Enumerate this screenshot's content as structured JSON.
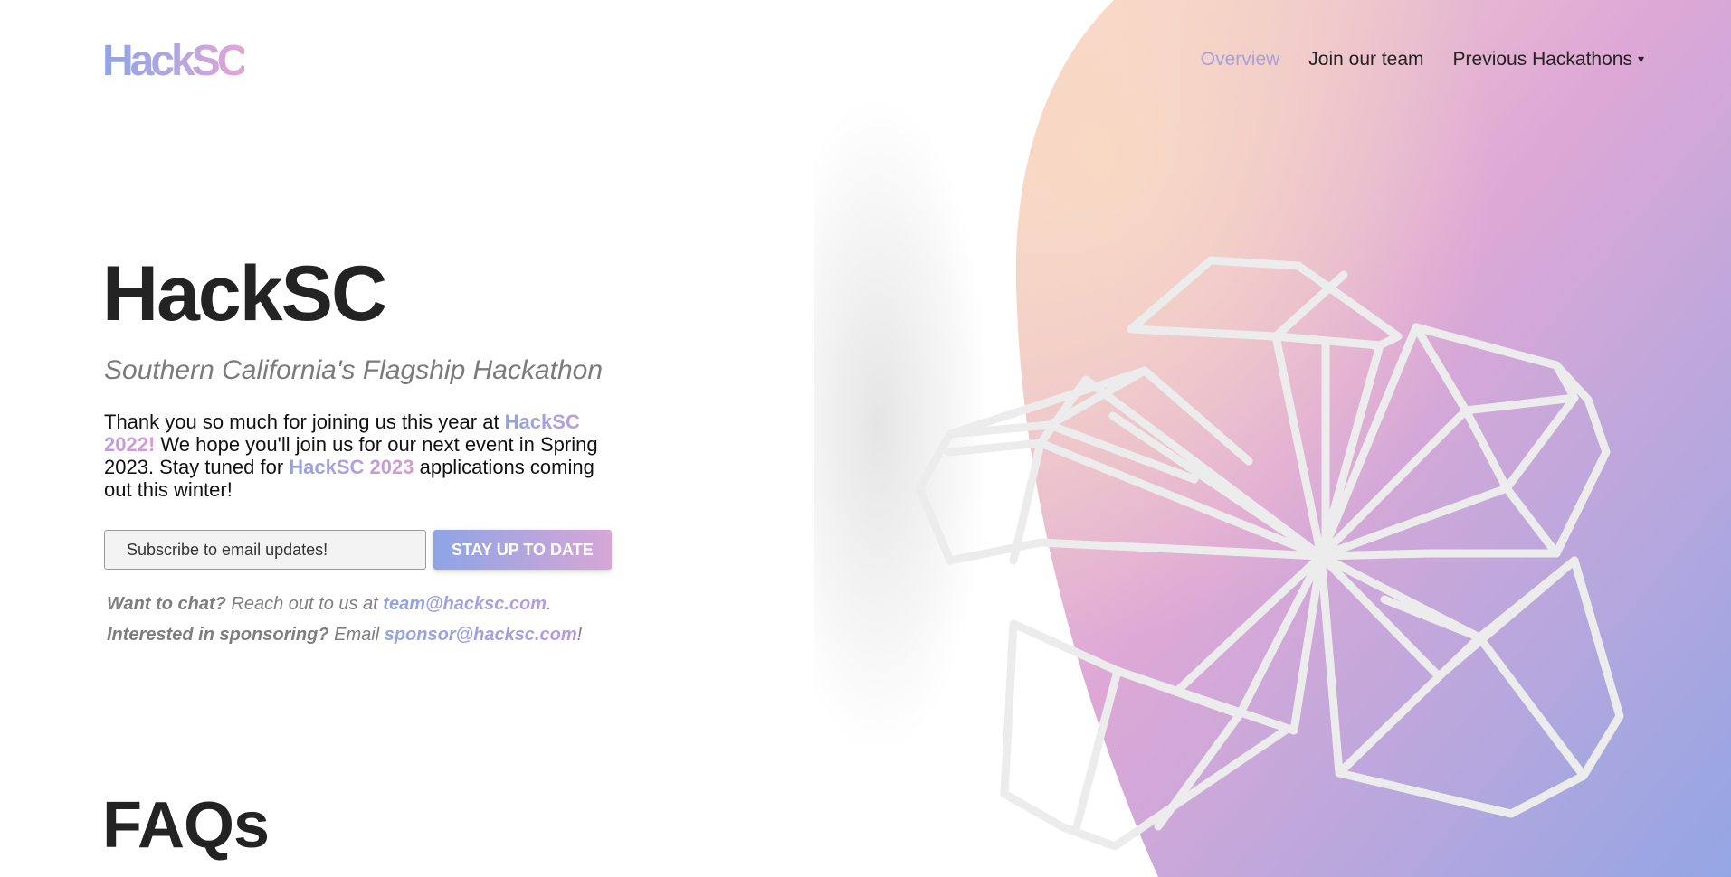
{
  "brand": {
    "logo": "HackSC"
  },
  "nav": {
    "overview": "Overview",
    "join": "Join our team",
    "previous": "Previous Hackathons",
    "caret": "▾"
  },
  "hero": {
    "title": "HackSC",
    "subtitle": "Southern California's Flagship Hackathon",
    "intro": {
      "p1": "Thank you so much for joining us this year at ",
      "hl1": "HackSC 2022!",
      "p2": " We hope you'll join us for our next event in Spring 2023. Stay tuned for ",
      "hl2": "HackSC 2023",
      "p3": " applications coming out this winter!"
    }
  },
  "subscribe": {
    "placeholder": "Subscribe to email updates!",
    "button": "STAY UP TO DATE"
  },
  "contact": {
    "chat_q": "Want to chat?",
    "chat_text": " Reach out to us at ",
    "chat_email": "team@hacksc.com",
    "chat_end": ".",
    "sponsor_q": "Interested in sponsoring?",
    "sponsor_text": " Email ",
    "sponsor_email": "sponsor@hacksc.com",
    "sponsor_end": "!"
  },
  "faq": {
    "heading": "FAQs"
  },
  "colors": {
    "gradient_start": "#f7d9c6",
    "gradient_mid": "#dca5d6",
    "gradient_end": "#93a6e4",
    "accent": "#a7a0dc"
  }
}
